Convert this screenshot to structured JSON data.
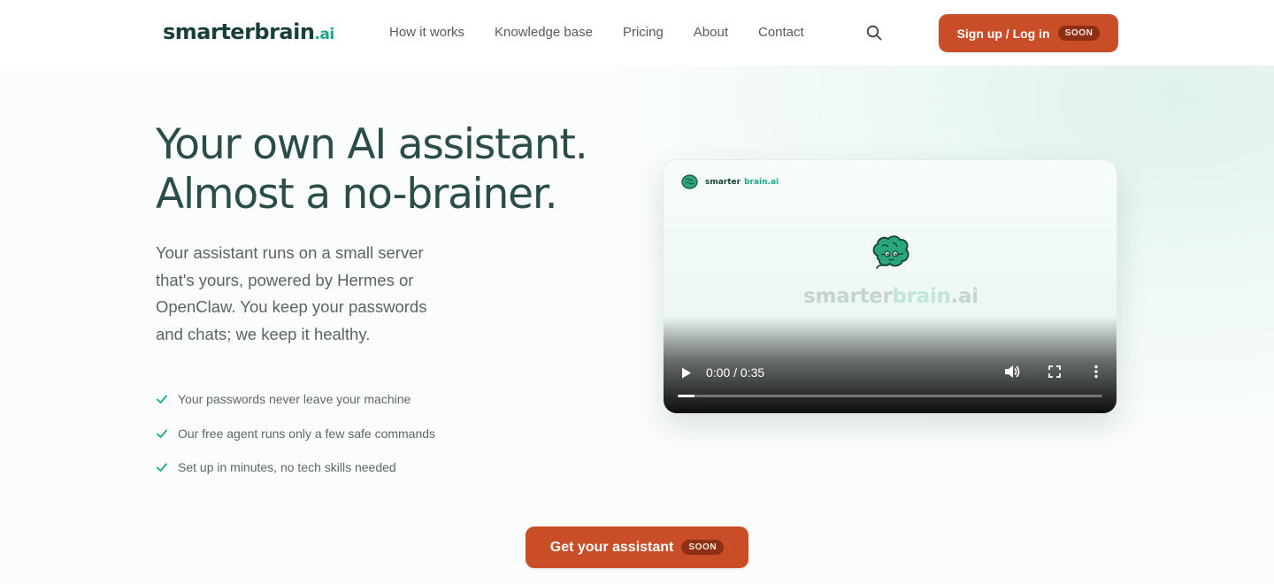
{
  "header": {
    "logo": {
      "main": "smarterbrain",
      "suffix": ".ai"
    },
    "nav": [
      "How it works",
      "Knowledge base",
      "Pricing",
      "About",
      "Contact"
    ],
    "signup": {
      "label": "Sign up / Log in",
      "badge": "SOON"
    }
  },
  "hero": {
    "title_line1": "Your own AI assistant.",
    "title_line2": "Almost a no-brainer.",
    "lede": "Your assistant runs on a small server that's yours, powered by Hermes or OpenClaw. You keep your passwords and chats; we keep it healthy.",
    "features": [
      "Your passwords never leave your machine",
      "Our free agent runs only a few safe commands",
      "Set up in minutes, no tech skills needed"
    ]
  },
  "video": {
    "mini_logo": {
      "main": "smarter",
      "accent": "brain.ai"
    },
    "wordmark": {
      "main": "smarter",
      "accent": "brain",
      "suffix": ".ai"
    },
    "time": "0:00 / 0:35",
    "progress": 0.04
  },
  "cta": {
    "label": "Get your assistant",
    "badge": "SOON"
  },
  "colors": {
    "accent": "#c94e27",
    "brand_green": "#18a88a",
    "heading": "#2b4d4a"
  }
}
